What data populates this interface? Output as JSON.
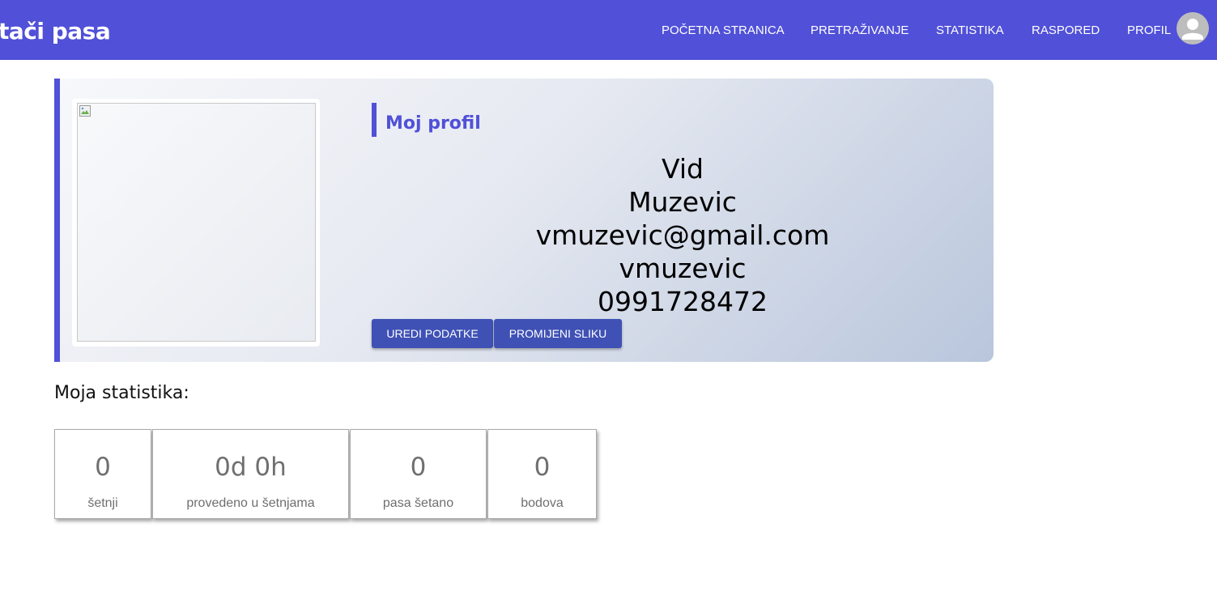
{
  "header": {
    "brand": "tači pasa",
    "nav": [
      "POČETNA STRANICA",
      "PRETRAŽIVANJE",
      "STATISTIKA",
      "RASPORED",
      "PROFIL"
    ],
    "avatar_icon": "account-circle-icon",
    "background_color": "#5050d8"
  },
  "profile": {
    "heading": "Moj profil",
    "first_name": "Vid",
    "last_name": "Muzevic",
    "email": "vmuzevic@gmail.com",
    "username": "vmuzevic",
    "phone": "0991728472",
    "photo_icon": "broken-image-icon",
    "buttons": {
      "edit": "UREDI PODATKE",
      "change_photo": "PROMIJENI SLIKU"
    },
    "accent_color": "#5050d8",
    "button_color": "#3f51b5"
  },
  "stats": {
    "title": "Moja statistika:",
    "items": [
      {
        "value": "0",
        "label": "šetnji"
      },
      {
        "value": "0d 0h",
        "label": "provedeno u šetnjama"
      },
      {
        "value": "0",
        "label": "pasa šetano"
      },
      {
        "value": "0",
        "label": "bodova"
      }
    ]
  }
}
